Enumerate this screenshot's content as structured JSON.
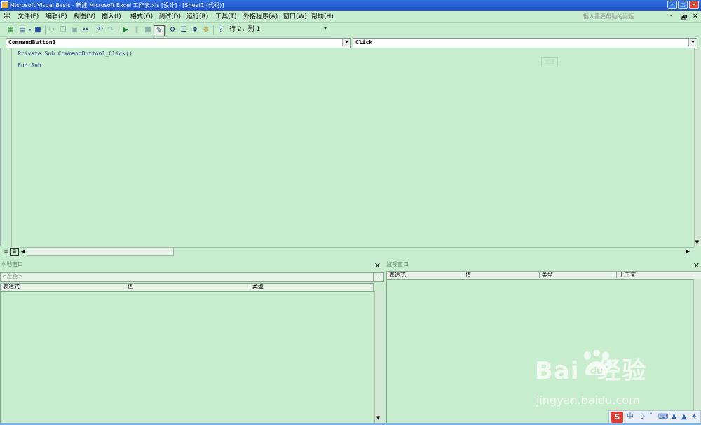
{
  "title_bar": {
    "title": "Microsoft Visual Basic - 新建 Microsoft Excel 工作表.xls [设计] - [Sheet1 (代码)]",
    "minimize": "–",
    "maximize": "□",
    "close": "✕"
  },
  "menu": {
    "items": [
      "文件(F)",
      "编辑(E)",
      "视图(V)",
      "插入(I)",
      "格式(O)",
      "调试(D)",
      "运行(R)",
      "工具(T)",
      "外接程序(A)",
      "窗口(W)",
      "帮助(H)"
    ],
    "help_search": "键入需要帮助的问题",
    "mdi_min": "-",
    "mdi_restore": "🗗",
    "mdi_close": "×"
  },
  "toolbar": {
    "cursor_position": "行 2，列 1"
  },
  "code_window": {
    "object_combo": "CommandButton1",
    "procedure_combo": "Click",
    "lines": [
      "Private Sub CommandButton1_Click()",
      "End Sub"
    ],
    "ghost_button": "关闭"
  },
  "locals_window": {
    "title": "本地窗口",
    "context": "<准备>",
    "context_button": "...",
    "columns": [
      "表达式",
      "值",
      "类型"
    ]
  },
  "watch_window": {
    "title": "监视窗口",
    "columns": [
      "表达式",
      "值",
      "类型",
      "上下文"
    ]
  },
  "watermark": {
    "logo": "Bai  经验",
    "logo_du": "du",
    "url": "jingyan.baidu.com"
  },
  "ime_tray": {
    "logo": "S",
    "mode": "中"
  },
  "colors": {
    "background": "#c8ecce",
    "titlebar": "#1f51c9",
    "code_text": "#1b2f7a"
  }
}
